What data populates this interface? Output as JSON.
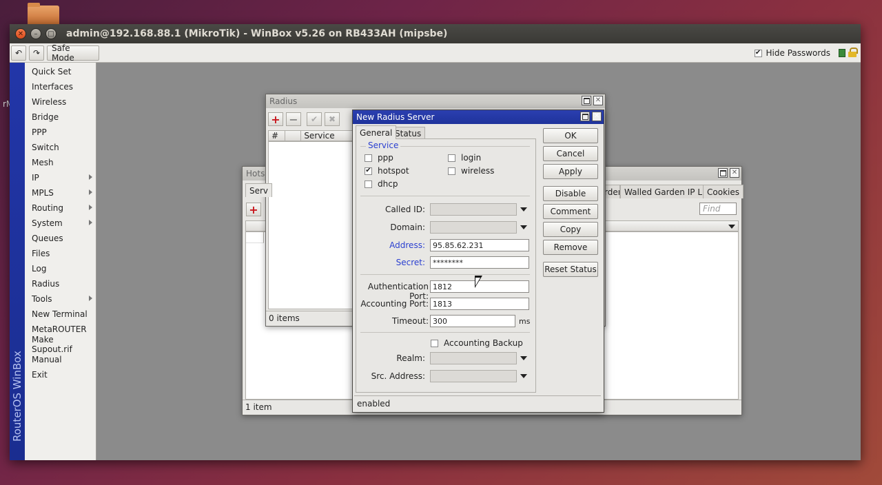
{
  "window": {
    "title": "admin@192.168.88.1 (MikroTik) - WinBox v5.26 on RB433AH (mipsbe)"
  },
  "desktop": {
    "side_text": "rM"
  },
  "toolbar": {
    "safe_mode": "Safe Mode",
    "hide_passwords": "Hide Passwords",
    "hide_passwords_checked": true
  },
  "sidebar": {
    "brand": "RouterOS WinBox",
    "items": [
      {
        "label": "Quick Set",
        "submenu": false
      },
      {
        "label": "Interfaces",
        "submenu": false
      },
      {
        "label": "Wireless",
        "submenu": false
      },
      {
        "label": "Bridge",
        "submenu": false
      },
      {
        "label": "PPP",
        "submenu": false
      },
      {
        "label": "Switch",
        "submenu": false
      },
      {
        "label": "Mesh",
        "submenu": false
      },
      {
        "label": "IP",
        "submenu": true
      },
      {
        "label": "MPLS",
        "submenu": true
      },
      {
        "label": "Routing",
        "submenu": true
      },
      {
        "label": "System",
        "submenu": true
      },
      {
        "label": "Queues",
        "submenu": false
      },
      {
        "label": "Files",
        "submenu": false
      },
      {
        "label": "Log",
        "submenu": false
      },
      {
        "label": "Radius",
        "submenu": false
      },
      {
        "label": "Tools",
        "submenu": true
      },
      {
        "label": "New Terminal",
        "submenu": false
      },
      {
        "label": "MetaROUTER",
        "submenu": false
      },
      {
        "label": "Make Supout.rif",
        "submenu": false
      },
      {
        "label": "Manual",
        "submenu": false
      },
      {
        "label": "Exit",
        "submenu": false
      }
    ]
  },
  "hotspot_window": {
    "title": "Hotsp",
    "tab_partial": "Serv",
    "tabs_right": [
      "rden",
      "Walled Garden IP List",
      "Cookies"
    ],
    "find_placeholder": "Find",
    "status": "1 item"
  },
  "radius_window": {
    "title": "Radius",
    "columns": [
      "#",
      "Service"
    ],
    "status": "0 items"
  },
  "dialog": {
    "title": "New Radius Server",
    "tabs": [
      "General",
      "Status"
    ],
    "service_legend": "Service",
    "services": [
      {
        "label": "ppp",
        "checked": false
      },
      {
        "label": "login",
        "checked": false
      },
      {
        "label": "hotspot",
        "checked": true
      },
      {
        "label": "wireless",
        "checked": false
      },
      {
        "label": "dhcp",
        "checked": false
      }
    ],
    "fields": {
      "called_id_label": "Called ID:",
      "domain_label": "Domain:",
      "address_label": "Address:",
      "address_value": "95.85.62.231",
      "secret_label": "Secret:",
      "secret_value": "********",
      "auth_port_label": "Authentication Port:",
      "auth_port_value": "1812",
      "acct_port_label": "Accounting Port:",
      "acct_port_value": "1813",
      "timeout_label": "Timeout:",
      "timeout_value": "300",
      "timeout_unit": "ms",
      "acct_backup_label": "Accounting Backup",
      "realm_label": "Realm:",
      "src_address_label": "Src. Address:"
    },
    "buttons": [
      "OK",
      "Cancel",
      "Apply",
      "Disable",
      "Comment",
      "Copy",
      "Remove",
      "Reset Status"
    ],
    "status": "enabled"
  }
}
